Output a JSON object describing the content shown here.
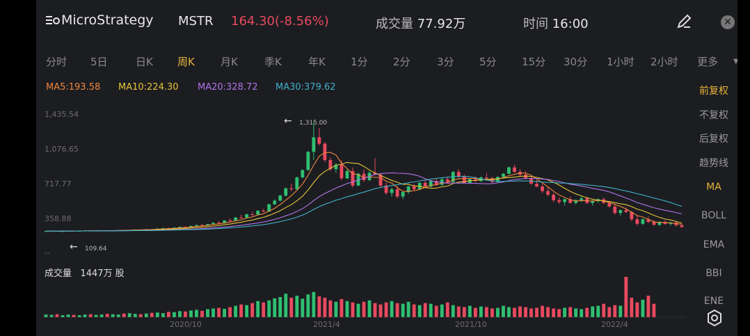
{
  "header": {
    "app_name": "MicroStrategy",
    "symbol": "MSTR",
    "price_change": "164.30(-8.56%)",
    "volume_label": "成交量",
    "volume_value": "77.92万",
    "time_label": "时间",
    "time_value": "16:00"
  },
  "tabs": [
    "分时",
    "5日",
    "日K",
    "周K",
    "月K",
    "季K",
    "年K",
    "1分",
    "2分",
    "3分",
    "5分",
    "15分",
    "30分",
    "1小时",
    "2小时",
    "更多"
  ],
  "active_tab": "周K",
  "ma_legend": [
    {
      "text": "MA5:193.58",
      "color": "#f0883e"
    },
    {
      "text": "MA10:224.30",
      "color": "#e6c43a"
    },
    {
      "text": "MA20:328.72",
      "color": "#b073e8"
    },
    {
      "text": "MA30:379.62",
      "color": "#3fb0c8"
    }
  ],
  "right_panel": [
    "前复权",
    "不复权",
    "后复权",
    "趋势线",
    "MA",
    "BOLL",
    "EMA",
    "BBI",
    "ENE"
  ],
  "right_panel_active": [
    "前复权",
    "MA"
  ],
  "y_axis_labels": [
    "1,435.54",
    "1,076.65",
    "717.77",
    "358.88",
    "--"
  ],
  "x_axis_labels": [
    "2020/10",
    "2021/4",
    "2021/10",
    "2022/4"
  ],
  "annotations": {
    "high": "1,315.00",
    "low": "109.64"
  },
  "volume_panel": {
    "title": "成交量",
    "value": "1447万 股"
  },
  "colors": {
    "up": "#2fbf71",
    "down": "#e84a5f",
    "accent": "#e6b33a",
    "background": "#1c1d21"
  },
  "chart_data": {
    "type": "candlestick",
    "ylim": [
      0,
      1435.54
    ],
    "candles": [
      [
        120,
        122,
        118,
        121
      ],
      [
        121,
        124,
        119,
        123
      ],
      [
        123,
        124,
        117,
        118
      ],
      [
        118,
        122,
        116,
        121
      ],
      [
        121,
        125,
        120,
        124
      ],
      [
        124,
        126,
        121,
        122
      ],
      [
        122,
        125,
        120,
        124
      ],
      [
        124,
        128,
        123,
        127
      ],
      [
        127,
        128,
        122,
        123
      ],
      [
        123,
        127,
        122,
        126
      ],
      [
        126,
        129,
        124,
        128
      ],
      [
        128,
        130,
        125,
        126
      ],
      [
        126,
        129,
        124,
        128
      ],
      [
        128,
        132,
        127,
        131
      ],
      [
        131,
        133,
        128,
        130
      ],
      [
        130,
        135,
        129,
        134
      ],
      [
        134,
        138,
        132,
        137
      ],
      [
        137,
        140,
        134,
        136
      ],
      [
        136,
        142,
        135,
        141
      ],
      [
        141,
        145,
        138,
        140
      ],
      [
        140,
        150,
        139,
        148
      ],
      [
        148,
        155,
        146,
        153
      ],
      [
        153,
        158,
        149,
        151
      ],
      [
        151,
        162,
        150,
        160
      ],
      [
        160,
        170,
        158,
        168
      ],
      [
        168,
        175,
        164,
        166
      ],
      [
        166,
        180,
        165,
        178
      ],
      [
        178,
        190,
        176,
        188
      ],
      [
        188,
        195,
        182,
        185
      ],
      [
        185,
        200,
        184,
        198
      ],
      [
        198,
        215,
        196,
        212
      ],
      [
        212,
        230,
        208,
        210
      ],
      [
        210,
        240,
        209,
        238
      ],
      [
        238,
        260,
        232,
        236
      ],
      [
        236,
        275,
        234,
        270
      ],
      [
        270,
        300,
        262,
        268
      ],
      [
        268,
        310,
        266,
        305
      ],
      [
        305,
        330,
        298,
        302
      ],
      [
        302,
        350,
        300,
        345
      ],
      [
        345,
        365,
        330,
        335
      ],
      [
        335,
        420,
        333,
        415
      ],
      [
        415,
        470,
        405,
        455
      ],
      [
        455,
        520,
        445,
        510
      ],
      [
        510,
        600,
        500,
        590
      ],
      [
        590,
        640,
        560,
        580
      ],
      [
        580,
        720,
        575,
        710
      ],
      [
        710,
        800,
        700,
        790
      ],
      [
        790,
        1000,
        785,
        990
      ],
      [
        990,
        1315,
        900,
        1150
      ],
      [
        1150,
        1250,
        1060,
        1080
      ],
      [
        1080,
        1100,
        880,
        900
      ],
      [
        900,
        930,
        780,
        800
      ],
      [
        800,
        870,
        760,
        850
      ],
      [
        850,
        900,
        680,
        700
      ],
      [
        700,
        800,
        690,
        780
      ],
      [
        780,
        820,
        600,
        620
      ],
      [
        620,
        760,
        615,
        750
      ],
      [
        750,
        800,
        660,
        680
      ],
      [
        680,
        780,
        670,
        760
      ],
      [
        760,
        920,
        740,
        740
      ],
      [
        740,
        760,
        600,
        620
      ],
      [
        620,
        650,
        520,
        540
      ],
      [
        540,
        600,
        500,
        580
      ],
      [
        580,
        620,
        480,
        500
      ],
      [
        500,
        560,
        470,
        550
      ],
      [
        550,
        620,
        530,
        610
      ],
      [
        610,
        640,
        560,
        580
      ],
      [
        580,
        660,
        570,
        650
      ],
      [
        650,
        680,
        600,
        610
      ],
      [
        610,
        680,
        600,
        670
      ],
      [
        670,
        700,
        620,
        630
      ],
      [
        630,
        700,
        620,
        690
      ],
      [
        690,
        720,
        650,
        660
      ],
      [
        660,
        780,
        655,
        770
      ],
      [
        770,
        800,
        700,
        720
      ],
      [
        720,
        740,
        640,
        650
      ],
      [
        650,
        700,
        640,
        690
      ],
      [
        690,
        720,
        660,
        670
      ],
      [
        670,
        720,
        660,
        710
      ],
      [
        710,
        760,
        680,
        700
      ],
      [
        700,
        720,
        640,
        660
      ],
      [
        660,
        720,
        655,
        715
      ],
      [
        715,
        760,
        700,
        750
      ],
      [
        750,
        830,
        745,
        820
      ],
      [
        820,
        850,
        760,
        770
      ],
      [
        770,
        800,
        720,
        740
      ],
      [
        740,
        780,
        690,
        700
      ],
      [
        700,
        720,
        630,
        640
      ],
      [
        640,
        680,
        600,
        610
      ],
      [
        610,
        640,
        540,
        560
      ],
      [
        560,
        600,
        500,
        520
      ],
      [
        520,
        540,
        440,
        460
      ],
      [
        460,
        490,
        420,
        440
      ],
      [
        440,
        480,
        400,
        470
      ],
      [
        470,
        500,
        420,
        430
      ],
      [
        430,
        470,
        410,
        460
      ],
      [
        460,
        500,
        440,
        480
      ],
      [
        480,
        500,
        420,
        430
      ],
      [
        430,
        460,
        400,
        450
      ],
      [
        450,
        480,
        430,
        470
      ],
      [
        470,
        490,
        420,
        430
      ],
      [
        430,
        450,
        380,
        390
      ],
      [
        390,
        420,
        300,
        320
      ],
      [
        320,
        360,
        290,
        350
      ],
      [
        350,
        380,
        320,
        330
      ],
      [
        330,
        340,
        230,
        250
      ],
      [
        250,
        290,
        180,
        200
      ],
      [
        200,
        260,
        190,
        250
      ],
      [
        250,
        280,
        210,
        220
      ],
      [
        220,
        240,
        180,
        190
      ],
      [
        190,
        230,
        175,
        220
      ],
      [
        220,
        240,
        190,
        200
      ],
      [
        200,
        225,
        180,
        215
      ],
      [
        215,
        230,
        170,
        185
      ],
      [
        185,
        200,
        160,
        164
      ]
    ],
    "volume": [
      8,
      7,
      9,
      6,
      8,
      7,
      6,
      8,
      9,
      7,
      8,
      10,
      9,
      8,
      11,
      12,
      10,
      9,
      11,
      13,
      14,
      12,
      16,
      15,
      18,
      17,
      20,
      22,
      19,
      24,
      26,
      28,
      25,
      30,
      34,
      38,
      36,
      42,
      48,
      44,
      50,
      56,
      60,
      70,
      58,
      64,
      55,
      68,
      75,
      62,
      58,
      50,
      46,
      54,
      48,
      44,
      40,
      46,
      50,
      42,
      38,
      44,
      48,
      42,
      40,
      46,
      38,
      36,
      42,
      40,
      34,
      38,
      44,
      36,
      32,
      30,
      34,
      28,
      32,
      30,
      26,
      28,
      34,
      30,
      28,
      32,
      30,
      26,
      28,
      34,
      30,
      26,
      24,
      28,
      30,
      26,
      24,
      28,
      32,
      34,
      40,
      30,
      36,
      34,
      120,
      58,
      44,
      52,
      64,
      40
    ]
  }
}
